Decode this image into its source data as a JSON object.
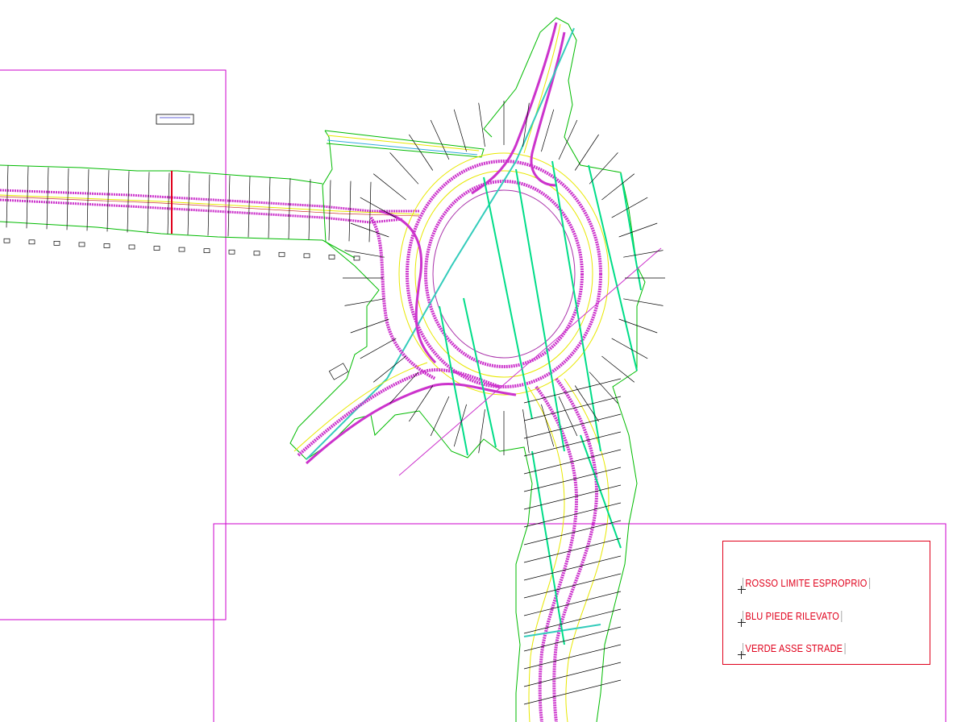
{
  "legend": {
    "items": [
      {
        "label": "ROSSO LIMITE ESPROPRIO",
        "color": "#e0001b"
      },
      {
        "label": "BLU PIEDE RILEVATO",
        "color": "#e0001b"
      },
      {
        "label": "VERDE ASSE STRADE",
        "color": "#e0001b"
      }
    ]
  },
  "colors": {
    "sheet_border": "#cc00cc",
    "road_edge": "#cc33cc",
    "embankment": "#00bb00",
    "axis": "#00dd88",
    "shoulder": "#e8e800",
    "section_line": "#000000",
    "legend_red": "#e0001b"
  }
}
